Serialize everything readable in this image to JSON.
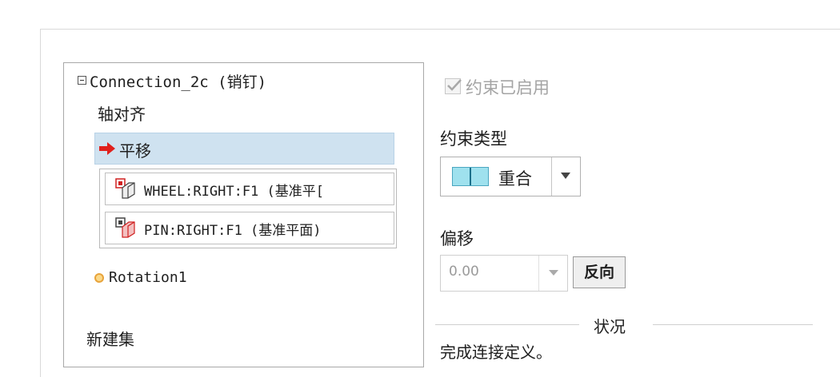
{
  "tree": {
    "connection_label": "Connection_2c (销钉)",
    "axis_align_label": "轴对齐",
    "translation_label": "平移",
    "references": [
      {
        "text": "WHEEL:RIGHT:F1 (基准平[",
        "icon": "datum-plane-icon"
      },
      {
        "text": "PIN:RIGHT:F1 (基准平面)",
        "icon": "datum-plane-icon"
      }
    ],
    "rotation_label": "Rotation1",
    "new_set_label": "新建集"
  },
  "constraint": {
    "enabled_label": "约束已启用",
    "enabled": true,
    "type_label": "约束类型",
    "type_value": "重合",
    "offset_label": "偏移",
    "offset_value": "0.00",
    "reverse_label": "反向"
  },
  "status": {
    "title": "状况",
    "text": "完成连接定义。"
  },
  "colors": {
    "selection": "#cfe2f0",
    "arrow": "#e0201c",
    "rotation_dot": "#e8a33a",
    "coincident_icon": "#9fe1ee"
  }
}
